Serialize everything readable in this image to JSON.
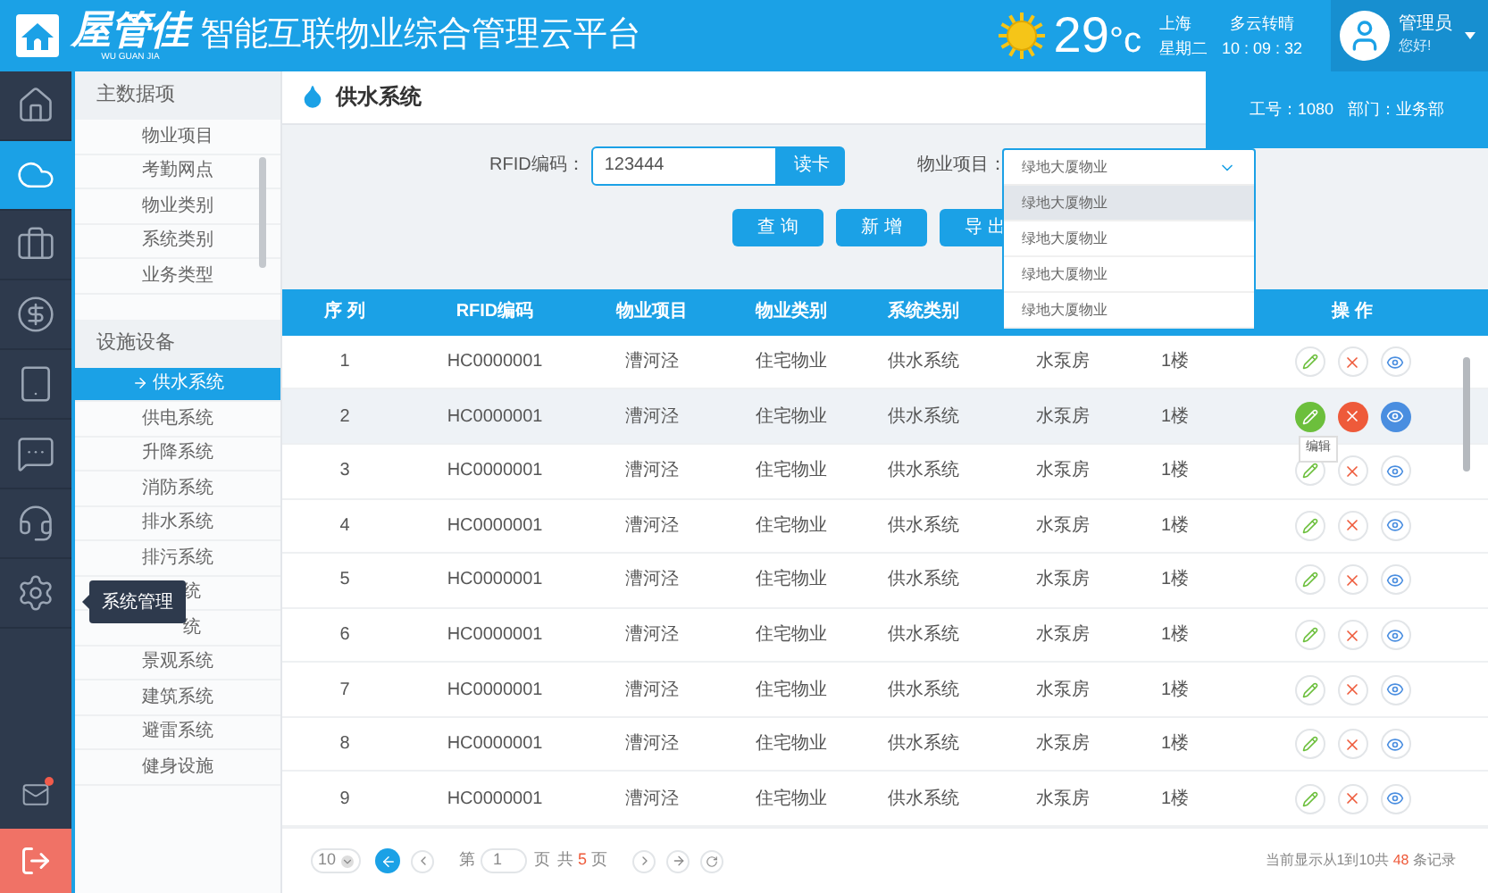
{
  "header": {
    "logo": "屋管佳",
    "logo_sub": "WU GUAN JIA",
    "title": "智能互联物业综合管理云平台",
    "temperature": "29",
    "unit": "°c",
    "city": "上海",
    "weather": "多云转晴",
    "weekday": "星期二",
    "time": "10 : 09 : 32",
    "user": "管理员",
    "greeting": "您好!"
  },
  "user_panel": {
    "employee_no": "工号：1080",
    "department": "部门：业务部"
  },
  "rail": [
    {
      "kind": "home",
      "selected": false
    },
    {
      "kind": "cloud",
      "selected": true
    },
    {
      "kind": "briefcase",
      "selected": false
    },
    {
      "kind": "coin",
      "selected": false
    },
    {
      "kind": "tablet",
      "selected": false
    },
    {
      "kind": "message",
      "selected": false
    },
    {
      "kind": "headset",
      "selected": false
    },
    {
      "kind": "settings",
      "selected": false
    }
  ],
  "rail_tooltip": "系统管理",
  "mail": {
    "unread": true
  },
  "sidebar": [
    {
      "title": "主数据项",
      "items": [
        {
          "label": "物业项目",
          "selected": false
        },
        {
          "label": "考勤网点",
          "selected": false
        },
        {
          "label": "物业类别",
          "selected": false
        },
        {
          "label": "系统类别",
          "selected": false
        },
        {
          "label": "业务类型",
          "selected": false
        }
      ]
    },
    {
      "title": "设施设备",
      "items": [
        {
          "label": "供水系统",
          "selected": true
        },
        {
          "label": "供电系统",
          "selected": false
        },
        {
          "label": "升降系统",
          "selected": false
        },
        {
          "label": "消防系统",
          "selected": false
        },
        {
          "label": "排水系统",
          "selected": false
        },
        {
          "label": "排污系统",
          "selected": false
        },
        {
          "label": "统",
          "selected": false
        },
        {
          "label": "统",
          "selected": false
        },
        {
          "label": "景观系统",
          "selected": false
        },
        {
          "label": "建筑系统",
          "selected": false
        },
        {
          "label": "避雷系统",
          "selected": false
        },
        {
          "label": "健身设施",
          "selected": false
        }
      ]
    }
  ],
  "page_title": "供水系统",
  "filters": {
    "rfid_label": "RFID编码：",
    "rfid_value": "123444",
    "read_button": "读卡",
    "project_label": "物业项目：",
    "project_value": "绿地大厦物业",
    "options": [
      {
        "label": "绿地大厦物业",
        "selected": true
      },
      {
        "label": "绿地大厦物业",
        "selected": false
      },
      {
        "label": "绿地大厦物业",
        "selected": false
      },
      {
        "label": "绿地大厦物业",
        "selected": false
      }
    ]
  },
  "buttons": [
    "查 询",
    "新 增",
    "导 出"
  ],
  "table": {
    "columns": [
      "序 列",
      "RFID编码",
      "物业项目",
      "物业类别",
      "系统类别",
      "操 作"
    ],
    "rows": [
      {
        "cells": [
          "1",
          "HC0000001",
          "漕河泾",
          "住宅物业",
          "供水系统",
          "水泵房",
          "1楼"
        ],
        "hovered": false
      },
      {
        "cells": [
          "2",
          "HC0000001",
          "漕河泾",
          "住宅物业",
          "供水系统",
          "水泵房",
          "1楼"
        ],
        "hovered": true
      },
      {
        "cells": [
          "3",
          "HC0000001",
          "漕河泾",
          "住宅物业",
          "供水系统",
          "水泵房",
          "1楼"
        ],
        "hovered": false
      },
      {
        "cells": [
          "4",
          "HC0000001",
          "漕河泾",
          "住宅物业",
          "供水系统",
          "水泵房",
          "1楼"
        ],
        "hovered": false
      },
      {
        "cells": [
          "5",
          "HC0000001",
          "漕河泾",
          "住宅物业",
          "供水系统",
          "水泵房",
          "1楼"
        ],
        "hovered": false
      },
      {
        "cells": [
          "6",
          "HC0000001",
          "漕河泾",
          "住宅物业",
          "供水系统",
          "水泵房",
          "1楼"
        ],
        "hovered": false
      },
      {
        "cells": [
          "7",
          "HC0000001",
          "漕河泾",
          "住宅物业",
          "供水系统",
          "水泵房",
          "1楼"
        ],
        "hovered": false
      },
      {
        "cells": [
          "8",
          "HC0000001",
          "漕河泾",
          "住宅物业",
          "供水系统",
          "水泵房",
          "1楼"
        ],
        "hovered": false
      },
      {
        "cells": [
          "9",
          "HC0000001",
          "漕河泾",
          "住宅物业",
          "供水系统",
          "水泵房",
          "1楼"
        ],
        "hovered": false
      }
    ],
    "action_tooltip": "编辑"
  },
  "pagination": {
    "page_size": "10",
    "page_prefix": "第",
    "page": "1",
    "page_suffix": "页",
    "total_prefix": "共",
    "total_pages": "5",
    "total_suffix": "页",
    "summary_prefix": "当前显示从1到10共",
    "records": "48",
    "summary_suffix": "条记录"
  }
}
